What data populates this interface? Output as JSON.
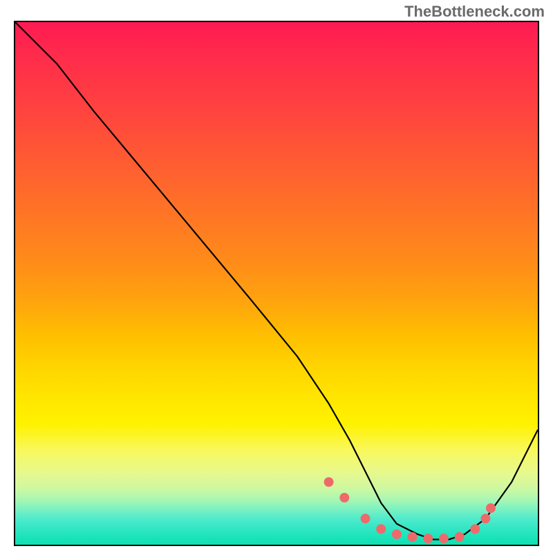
{
  "watermark": "TheBottleneck.com",
  "chart_data": {
    "type": "line",
    "title": "",
    "xlabel": "",
    "ylabel": "",
    "xlim": [
      0,
      100
    ],
    "ylim": [
      0,
      100
    ],
    "series": [
      {
        "name": "curve",
        "x": [
          0,
          8,
          15,
          25,
          35,
          45,
          54,
          60,
          64,
          67,
          70,
          73,
          77,
          80,
          83,
          86,
          90,
          95,
          100
        ],
        "values": [
          100,
          92,
          83,
          71,
          59,
          47,
          36,
          27,
          20,
          14,
          8,
          4,
          2,
          1,
          1,
          2,
          5,
          12,
          22
        ]
      }
    ],
    "markers": {
      "name": "dots",
      "color": "#ee6a6a",
      "x": [
        60,
        63,
        67,
        70,
        73,
        76,
        79,
        82,
        85,
        88,
        90,
        91
      ],
      "values": [
        12,
        9,
        5,
        3,
        2,
        1.5,
        1.2,
        1.2,
        1.5,
        3,
        5,
        7
      ]
    },
    "gradient_stops": [
      {
        "pos": 0,
        "color": "#ff1a52"
      },
      {
        "pos": 50,
        "color": "#ffb000"
      },
      {
        "pos": 80,
        "color": "#fff200"
      },
      {
        "pos": 100,
        "color": "#10e0b0"
      }
    ]
  }
}
